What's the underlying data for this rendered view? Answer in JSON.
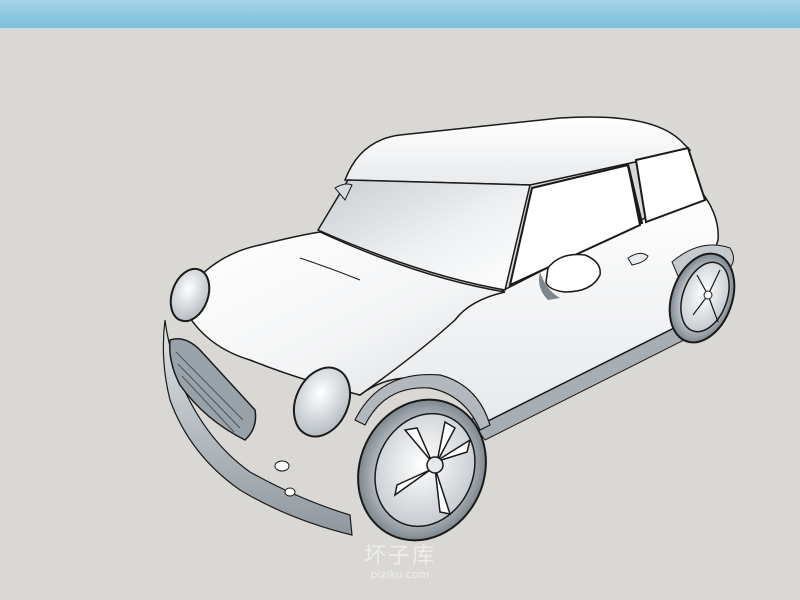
{
  "watermark": {
    "text": "坏子库",
    "subtext": "piziku.com"
  },
  "colors": {
    "sky_top": "#a8d4e8",
    "sky_bottom": "#7fbfdc",
    "ground": "#d9d8d4",
    "body": "#ffffff",
    "shadow": "#8e959c",
    "outline": "#1a1a1a"
  }
}
